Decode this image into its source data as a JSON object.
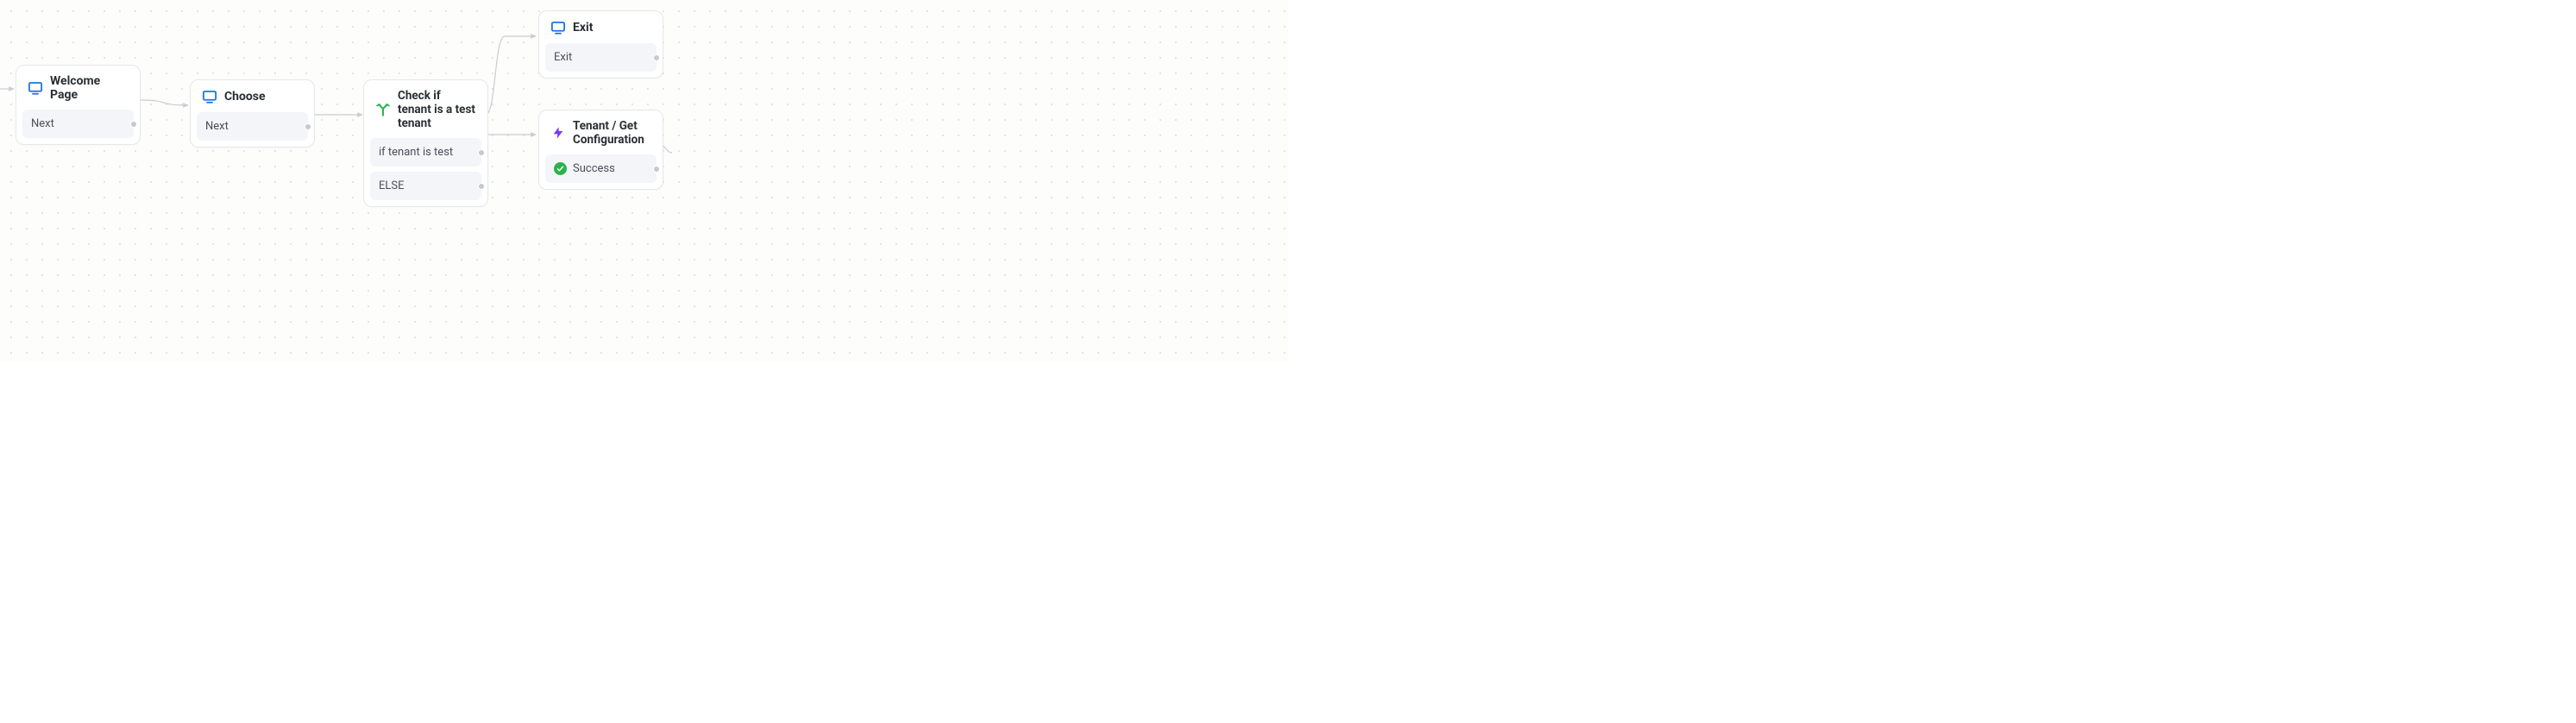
{
  "nodes": {
    "welcome": {
      "title": "Welcome Page",
      "ports": {
        "next": "Next"
      }
    },
    "choose": {
      "title": "Choose",
      "ports": {
        "next": "Next"
      }
    },
    "check": {
      "title": "Check if tenant is a test tenant",
      "ports": {
        "if": "if tenant is test",
        "else": "ELSE"
      }
    },
    "exit": {
      "title": "Exit",
      "ports": {
        "exit": "Exit"
      }
    },
    "config": {
      "title": "Tenant / Get Configuration",
      "ports": {
        "success": "Success"
      }
    }
  },
  "icons": {
    "screen": "screen-icon",
    "branch": "branch-icon",
    "bolt": "bolt-icon",
    "check": "check-icon"
  },
  "colors": {
    "screen": "#1a73e8",
    "branch": "#2bb24c",
    "bolt": "#7c3aed",
    "port_bg": "#f3f5f9",
    "node_border": "#e6e7ea",
    "edge": "#c9ccd2",
    "title": "#2b2f33"
  }
}
